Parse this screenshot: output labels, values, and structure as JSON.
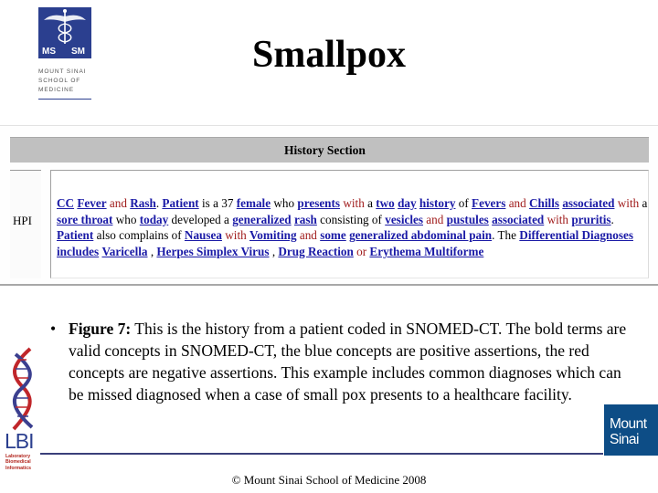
{
  "logos": {
    "mssm": {
      "emblem_letters": "MS   SM",
      "lines": [
        "MOUNT SINAI",
        "SCHOOL OF",
        "MEDICINE"
      ]
    },
    "lbi": {
      "letters": "LBI",
      "lines": [
        "Laboratory",
        "Biomedical",
        "Informatics"
      ]
    },
    "mount_sinai": {
      "line1": "Mount",
      "line2": "Sinai"
    }
  },
  "slide": {
    "title": "Smallpox"
  },
  "history": {
    "header": "History Section",
    "row_label": "HPI",
    "legend": {
      "concept_color": "#1a1aa6",
      "negative_color": "#a01c1c"
    },
    "segments": [
      {
        "t": "CC",
        "k": "c"
      },
      {
        "t": " ",
        "k": "p"
      },
      {
        "t": "Fever",
        "k": "c"
      },
      {
        "t": " and ",
        "k": "n"
      },
      {
        "t": "Rash",
        "k": "c"
      },
      {
        "t": ". ",
        "k": "p"
      },
      {
        "t": "Patient",
        "k": "c"
      },
      {
        "t": " is a 37 ",
        "k": "p"
      },
      {
        "t": "female",
        "k": "c"
      },
      {
        "t": " who ",
        "k": "p"
      },
      {
        "t": "presents",
        "k": "c"
      },
      {
        "t": " with",
        "k": "n"
      },
      {
        "t": " a ",
        "k": "p"
      },
      {
        "t": "two",
        "k": "c"
      },
      {
        "t": " ",
        "k": "p"
      },
      {
        "t": "day",
        "k": "c"
      },
      {
        "t": " ",
        "k": "p"
      },
      {
        "t": "history",
        "k": "c"
      },
      {
        "t": " of ",
        "k": "p"
      },
      {
        "t": "Fevers",
        "k": "c"
      },
      {
        "t": " and ",
        "k": "n"
      },
      {
        "t": "Chills",
        "k": "c"
      },
      {
        "t": " ",
        "k": "p"
      },
      {
        "t": "associated",
        "k": "c"
      },
      {
        "t": " with",
        "k": "n"
      },
      {
        "t": " a ",
        "k": "p"
      },
      {
        "t": "sore throat",
        "k": "c"
      },
      {
        "t": " who ",
        "k": "p"
      },
      {
        "t": "today",
        "k": "c"
      },
      {
        "t": " developed a ",
        "k": "p"
      },
      {
        "t": "generalized",
        "k": "c"
      },
      {
        "t": " ",
        "k": "p"
      },
      {
        "t": "rash",
        "k": "c"
      },
      {
        "t": " consisting of ",
        "k": "p"
      },
      {
        "t": "vesicles",
        "k": "c"
      },
      {
        "t": " and ",
        "k": "n"
      },
      {
        "t": "pustules",
        "k": "c"
      },
      {
        "t": " ",
        "k": "p"
      },
      {
        "t": "associated",
        "k": "c"
      },
      {
        "t": " with ",
        "k": "n"
      },
      {
        "t": "pruritis",
        "k": "c"
      },
      {
        "t": ". ",
        "k": "p"
      },
      {
        "t": "Patient",
        "k": "c"
      },
      {
        "t": " also complains of ",
        "k": "p"
      },
      {
        "t": "Nausea",
        "k": "c"
      },
      {
        "t": " with ",
        "k": "n"
      },
      {
        "t": "Vomiting",
        "k": "c"
      },
      {
        "t": " and ",
        "k": "n"
      },
      {
        "t": "some",
        "k": "c"
      },
      {
        "t": " ",
        "k": "p"
      },
      {
        "t": "generalized abdominal pain",
        "k": "c"
      },
      {
        "t": ". The ",
        "k": "p"
      },
      {
        "t": "Differential Diagnoses",
        "k": "c"
      },
      {
        "t": " ",
        "k": "p"
      },
      {
        "t": "includes",
        "k": "c"
      },
      {
        "t": " ",
        "k": "p"
      },
      {
        "t": "Varicella",
        "k": "c"
      },
      {
        "t": " , ",
        "k": "p"
      },
      {
        "t": "Herpes Simplex Virus",
        "k": "c"
      },
      {
        "t": " , ",
        "k": "p"
      },
      {
        "t": "Drug Reaction",
        "k": "c"
      },
      {
        "t": " or ",
        "k": "n"
      },
      {
        "t": "Erythema Multiforme",
        "k": "c"
      }
    ]
  },
  "caption": {
    "bullet": "•",
    "figure_label": "Figure 7:",
    "text": "  This is the history from a patient coded in SNOMED-CT.  The bold terms are valid concepts in SNOMED-CT, the blue concepts are positive assertions, the red concepts are negative assertions.  This example includes common diagnoses which can be missed diagnosed when a case of small pox presents to a healthcare facility."
  },
  "footer": {
    "copyright": "© Mount Sinai School of Medicine 2008"
  }
}
